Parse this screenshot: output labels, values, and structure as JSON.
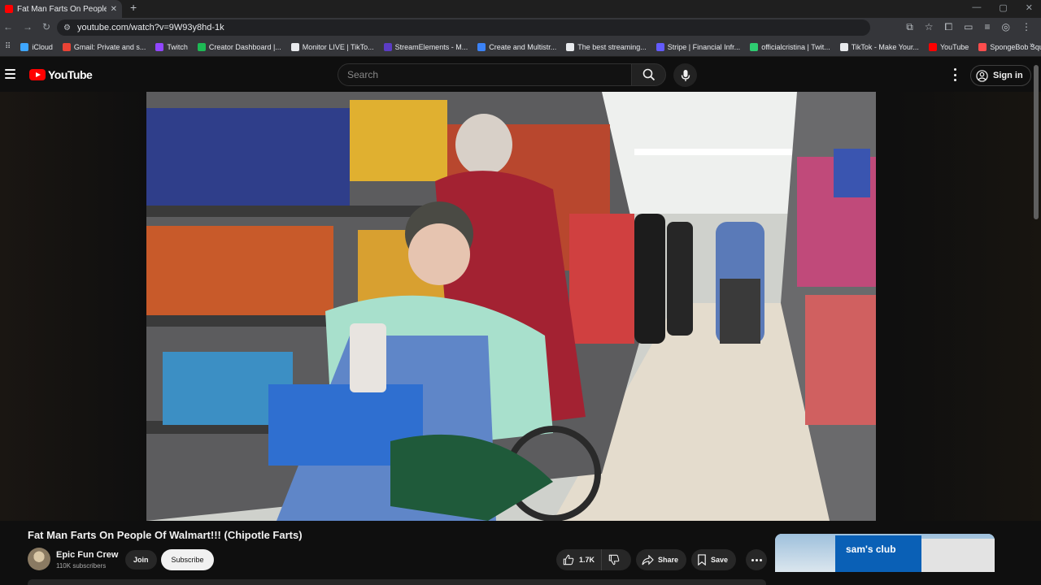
{
  "browser": {
    "tab_title": "Fat Man Farts On People Of",
    "tab_close": "✕",
    "new_tab": "+",
    "url": "youtube.com/watch?v=9W93y8hd-1k",
    "bookmarks": [
      {
        "label": "iCloud",
        "color": "#3ea6ff"
      },
      {
        "label": "Gmail: Private and s...",
        "color": "#ea4335"
      },
      {
        "label": "Twitch",
        "color": "#9146ff"
      },
      {
        "label": "Creator Dashboard |...",
        "color": "#1db954"
      },
      {
        "label": "Monitor LIVE | TikTo...",
        "color": "#e8eaed"
      },
      {
        "label": "StreamElements - M...",
        "color": "#5b3cc4"
      },
      {
        "label": "Create and Multistr...",
        "color": "#3b82f6"
      },
      {
        "label": "The best streaming...",
        "color": "#e8eaed"
      },
      {
        "label": "Stripe | Financial Infr...",
        "color": "#635bff"
      },
      {
        "label": "officialcristina | Twit...",
        "color": "#2ecc71"
      },
      {
        "label": "TikTok - Make Your...",
        "color": "#e8eaed"
      },
      {
        "label": "YouTube",
        "color": "#ff0000"
      },
      {
        "label": "SpongeBob Square...",
        "color": "#ff4d4d"
      }
    ]
  },
  "youtube": {
    "logo_text": "YouTube",
    "search_placeholder": "Search",
    "sign_in": "Sign in"
  },
  "video": {
    "title": "Fat Man Farts On People Of Walmart!!! (Chipotle Farts)",
    "channel": "Epic Fun Crew",
    "subscribers": "110K subscribers",
    "join": "Join",
    "subscribe": "Subscribe",
    "likes": "1.7K",
    "share": "Share",
    "save": "Save"
  },
  "ad": {
    "logo_text": "sam's club"
  },
  "colors": {
    "accent": "#ff0000",
    "background": "#0f0f0f"
  }
}
